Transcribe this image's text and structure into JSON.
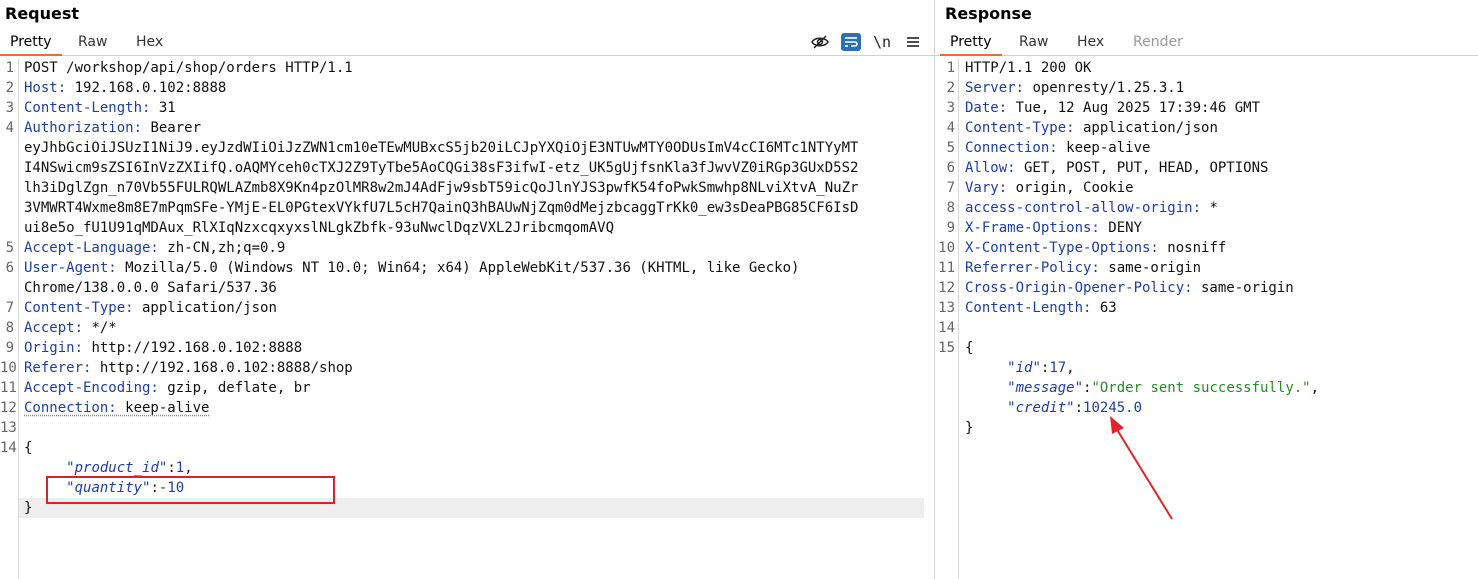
{
  "request": {
    "title": "Request",
    "tabs": [
      "Pretty",
      "Raw",
      "Hex"
    ],
    "active_tab": "Pretty",
    "toolbar": {
      "hide_icon": "eye-slash",
      "wrap_icon": "wrap",
      "newline_label": "\\n",
      "menu_icon": "menu"
    },
    "lines": [
      {
        "n": "1",
        "text": "POST /workshop/api/shop/orders HTTP/1.1"
      },
      {
        "n": "2",
        "key": "Host:",
        "val": " 192.168.0.102:8888"
      },
      {
        "n": "3",
        "key": "Content-Length:",
        "val": " 31"
      },
      {
        "n": "4",
        "key": "Authorization:",
        "val": " Bearer"
      },
      {
        "n": "",
        "text": "eyJhbGciOiJSUzI1NiJ9.eyJzdWIiOiJzZWN1cm10eTEwMUBxcS5jb20iLCJpYXQiOjE3NTUwMTY0ODUsImV4cCI6MTc1NTYyMT"
      },
      {
        "n": "",
        "text": "I4NSwicm9sZSI6InVzZXIifQ.oAQMYceh0cTXJ2Z9TyTbe5AoCQGi38sF3ifwI-etz_UK5gUjfsnKla3fJwvVZ0iRGp3GUxD5S2"
      },
      {
        "n": "",
        "text": "lh3iDglZgn_n70Vb55FULRQWLAZmb8X9Kn4pzOlMR8w2mJ4AdFjw9sbT59icQoJlnYJS3pwfK54foPwkSmwhp8NLviXtvA_NuZr"
      },
      {
        "n": "",
        "text": "3VMWRT4Wxme8m8E7mPqmSFe-YMjE-EL0PGtexVYkfU7L5cH7QainQ3hBAUwNjZqm0dMejzbcaggTrKk0_ew3sDeaPBG85CF6IsD"
      },
      {
        "n": "",
        "text": "ui8e5o_fU1U91qMDAux_RlXIqNzxcqxyxslNLgkZbfk-93uNwclDqzVXL2JribcmqomAVQ"
      },
      {
        "n": "5",
        "key": "Accept-Language:",
        "val": " zh-CN,zh;q=0.9"
      },
      {
        "n": "6",
        "key": "User-Agent:",
        "val": " Mozilla/5.0 (Windows NT 10.0; Win64; x64) AppleWebKit/537.36 (KHTML, like Gecko)"
      },
      {
        "n": "",
        "text": "Chrome/138.0.0.0 Safari/537.36"
      },
      {
        "n": "7",
        "key": "Content-Type:",
        "val": " application/json"
      },
      {
        "n": "8",
        "key": "Accept:",
        "val": " */*"
      },
      {
        "n": "9",
        "key": "Origin:",
        "val": " http://192.168.0.102:8888"
      },
      {
        "n": "10",
        "key": "Referer:",
        "val": " http://192.168.0.102:8888/shop"
      },
      {
        "n": "11",
        "key": "Accept-Encoding:",
        "val": " gzip, deflate, br"
      },
      {
        "n": "12",
        "key": "Connection:",
        "val": " keep-alive",
        "dotted": true
      },
      {
        "n": "13",
        "text": ""
      },
      {
        "n": "14",
        "text": "{"
      },
      {
        "n": "",
        "jkey": "\"product_id\"",
        "jsep": ":",
        "jnum": "1",
        "jend": ","
      },
      {
        "n": "",
        "jkey": "\"quantity\"",
        "jsep": ":",
        "jnum": "-10",
        "jend": ""
      },
      {
        "n": "",
        "text": "}"
      }
    ]
  },
  "response": {
    "title": "Response",
    "tabs": [
      "Pretty",
      "Raw",
      "Hex",
      "Render"
    ],
    "active_tab": "Pretty",
    "disabled_tab": "Render",
    "lines": [
      {
        "n": "1",
        "text": "HTTP/1.1 200 OK"
      },
      {
        "n": "2",
        "key": "Server:",
        "val": " openresty/1.25.3.1"
      },
      {
        "n": "3",
        "key": "Date:",
        "val": " Tue, 12 Aug 2025 17:39:46 GMT"
      },
      {
        "n": "4",
        "key": "Content-Type:",
        "val": " application/json"
      },
      {
        "n": "5",
        "key": "Connection:",
        "val": " keep-alive"
      },
      {
        "n": "6",
        "key": "Allow:",
        "val": " GET, POST, PUT, HEAD, OPTIONS"
      },
      {
        "n": "7",
        "key": "Vary:",
        "val": " origin, Cookie"
      },
      {
        "n": "8",
        "key": "access-control-allow-origin:",
        "val": " *"
      },
      {
        "n": "9",
        "key": "X-Frame-Options:",
        "val": " DENY"
      },
      {
        "n": "10",
        "key": "X-Content-Type-Options:",
        "val": " nosniff"
      },
      {
        "n": "11",
        "key": "Referrer-Policy:",
        "val": " same-origin"
      },
      {
        "n": "12",
        "key": "Cross-Origin-Opener-Policy:",
        "val": " same-origin"
      },
      {
        "n": "13",
        "key": "Content-Length:",
        "val": " 63"
      },
      {
        "n": "14",
        "text": ""
      },
      {
        "n": "15",
        "text": "{"
      },
      {
        "n": "",
        "jkey": "\"id\"",
        "jsep": ":",
        "jnum": "17",
        "jend": ","
      },
      {
        "n": "",
        "jkey": "\"message\"",
        "jsep": ":",
        "jstr": "\"Order sent successfully.\"",
        "jend": ","
      },
      {
        "n": "",
        "jkey": "\"credit\"",
        "jsep": ":",
        "jnum": "10245.0",
        "jend": ""
      },
      {
        "n": "",
        "text": "}"
      }
    ]
  },
  "colors": {
    "accent": "#e8702a",
    "header_key": "#1e3fa0",
    "json_string": "#2a8a2a",
    "annotation_red": "#d8232a"
  }
}
